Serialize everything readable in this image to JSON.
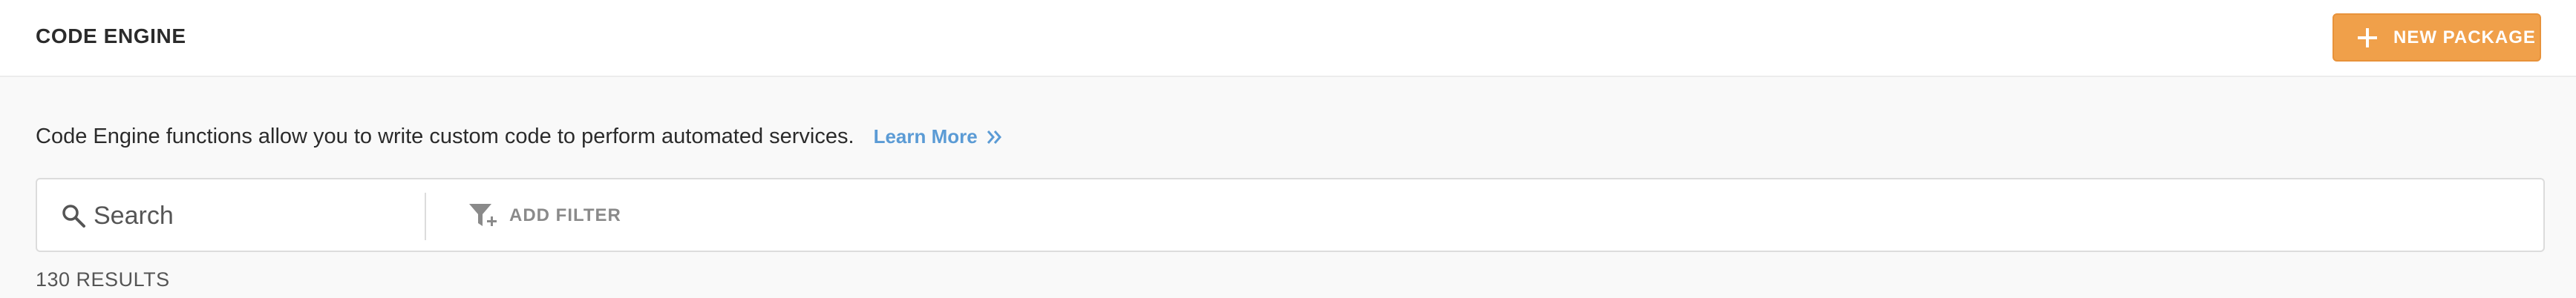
{
  "header": {
    "title": "CODE ENGINE",
    "new_package_label": "NEW PACKAGE",
    "new_package_icon": "plus-icon"
  },
  "intro": {
    "text": "Code Engine functions allow you to write custom code to perform automated services.",
    "learn_more_label": "Learn More",
    "learn_more_icon": "double-chevron-right-icon"
  },
  "search": {
    "placeholder": "Search",
    "value": "",
    "icon": "search-icon"
  },
  "filter": {
    "label": "ADD FILTER",
    "icon": "filter-add-icon"
  },
  "results": {
    "text": "130 RESULTS"
  },
  "colors": {
    "accent": "#f0a04a",
    "link": "#5b9bd5",
    "text": "#2b2b2b",
    "muted": "#8a8a8a"
  }
}
